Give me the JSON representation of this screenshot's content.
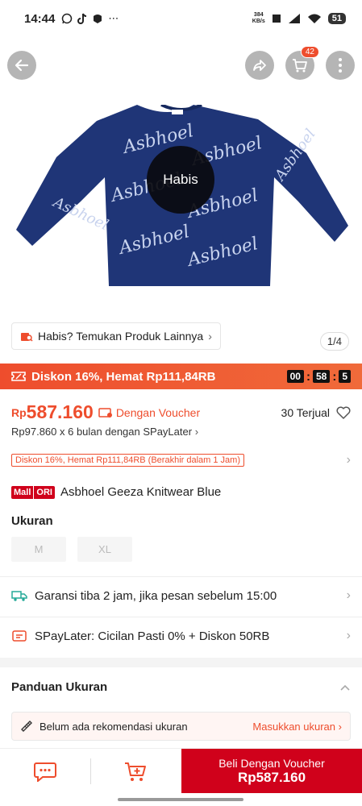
{
  "status": {
    "time": "14:44",
    "net_speed_top": "384",
    "net_speed_bottom": "KB/s",
    "battery": "51"
  },
  "header": {
    "cart_count": "42"
  },
  "product_image": {
    "overlay_text": "Habis",
    "sweater_print": "Asbhoel",
    "page_indicator": "1/4"
  },
  "find_other": {
    "label": "Habis? Temukan Produk Lainnya",
    "chevron": "›"
  },
  "flash": {
    "label": "Diskon 16%, Hemat Rp111,84RB",
    "hours": "00",
    "minutes": "58",
    "seconds": "5"
  },
  "price": {
    "currency": "Rp",
    "amount": "587.160",
    "voucher_label": "Dengan Voucher",
    "sold": "30 Terjual",
    "paylater": "Rp97.860 x 6 bulan dengan SPayLater",
    "promo_tag": "Diskon 16%, Hemat Rp111,84RB (Berakhir dalam 1 Jam)"
  },
  "product": {
    "mall_tag_1": "Mall",
    "mall_tag_2": "ORI",
    "name": "Asbhoel Geeza Knitwear Blue"
  },
  "size": {
    "label": "Ukuran",
    "options": [
      "M",
      "XL"
    ]
  },
  "info": {
    "shipping": "Garansi tiba 2 jam, jika pesan sebelum 15:00",
    "spaylater": "SPayLater: Cicilan Pasti 0% + Diskon 50RB"
  },
  "size_guide": {
    "title": "Panduan Ukuran",
    "reco": "Belum ada rekomendasi ukuran",
    "reco_action": "Masukkan ukuran"
  },
  "bottom": {
    "buy_line1": "Beli Dengan Voucher",
    "buy_line2": "Rp587.160"
  },
  "colors": {
    "accent": "#ee4d2d",
    "buy": "#d0011b",
    "sweater": "#1f3577"
  }
}
